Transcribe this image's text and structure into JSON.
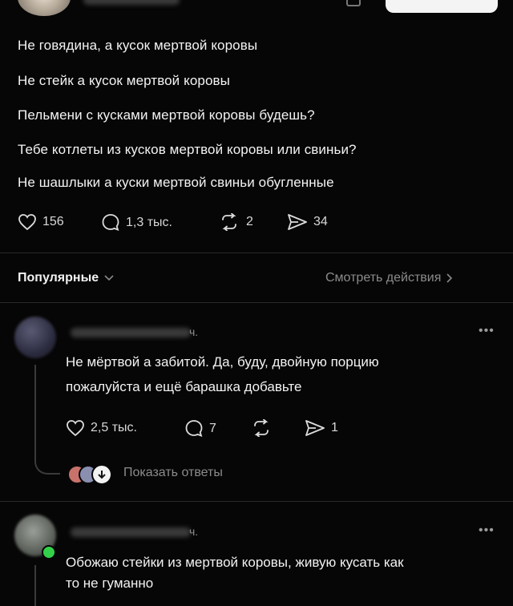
{
  "post": {
    "lines": [
      "Не говядина, а кусок мертвой коровы",
      "Не стейк а кусок мертвой коровы",
      "Пельмени с кусками мертвой коровы будешь?",
      "Тебе котлеты из кусков мертвой коровы или свиньи?",
      "Не шашлыки а куски мертвой свиньи обугленные"
    ],
    "likes": "156",
    "comments": "1,3 тыс.",
    "reposts": "2",
    "shares": "34"
  },
  "sort": {
    "label": "Популярные",
    "activity_link": "Смотреть действия"
  },
  "replies": [
    {
      "time": "ч.",
      "text_line1": "Не мёртвой а забитой. Да, буду, двойную порцию",
      "text_line2": "пожалуйста и ещё  барашка добавьте",
      "likes": "2,5 тыс.",
      "comments": "7",
      "shares": "1",
      "show_replies": "Показать ответы"
    },
    {
      "time": "ч.",
      "text_line1": "Обожаю стейки из мертвой коровы, живую кусать как",
      "text_line2": "то не гуманно"
    }
  ],
  "icons": [
    "heart-icon",
    "comment-icon",
    "repost-icon",
    "share-icon",
    "chevron-down-icon",
    "chevron-right-icon",
    "more-icon"
  ],
  "colors": {
    "background": "#060606",
    "text": "#f2f2f2",
    "muted": "#8b8b8b",
    "online": "#33d14a"
  }
}
